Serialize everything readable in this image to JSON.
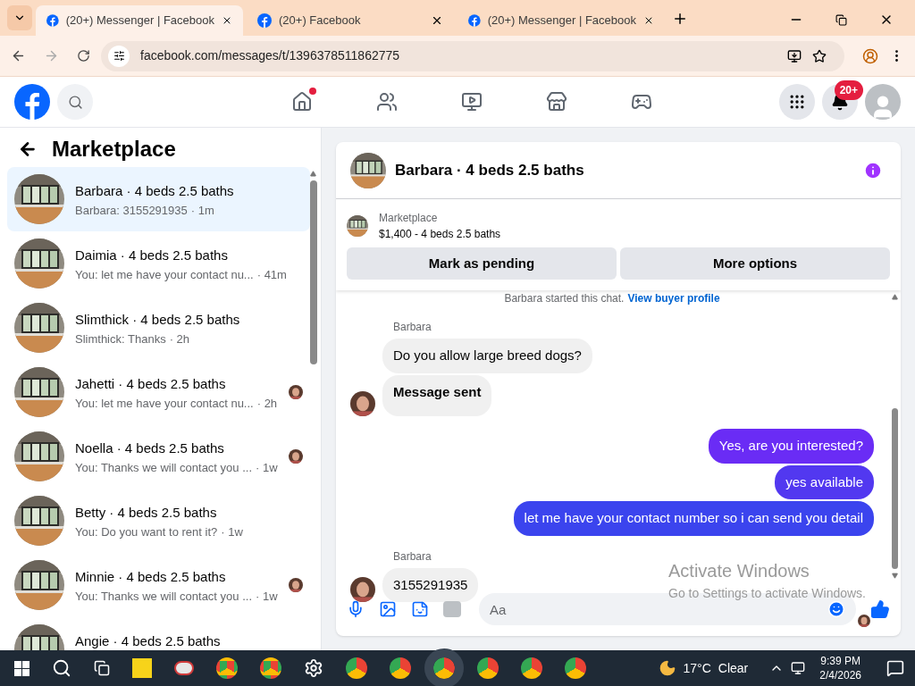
{
  "browser": {
    "tabs": [
      {
        "title": "(20+) Messenger | Facebook",
        "selected": true
      },
      {
        "title": "(20+) Facebook",
        "selected": false
      },
      {
        "title": "(20+) Messenger | Facebook",
        "selected": false
      }
    ],
    "url": "facebook.com/messages/t/1396378511862775"
  },
  "top_nav": {
    "home_unread": true,
    "notification_badge": "20+"
  },
  "sidebar": {
    "title": "Marketplace",
    "conversations": [
      {
        "title": "Barbara · 4 beds 2.5 baths",
        "preview": "Barbara: 3155291935",
        "time": "· 1m",
        "selected": true,
        "seen_avatar": false
      },
      {
        "title": "Daimia · 4 beds 2.5 baths",
        "preview": "You: let me have your contact nu...",
        "time": "· 41m",
        "selected": false,
        "seen_avatar": false
      },
      {
        "title": "Slimthick · 4 beds 2.5 baths",
        "preview": "Slimthick: Thanks",
        "time": "· 2h",
        "selected": false,
        "seen_avatar": false
      },
      {
        "title": "Jahetti · 4 beds 2.5 baths",
        "preview": "You: let me have your contact nu...",
        "time": "· 2h",
        "selected": false,
        "seen_avatar": true
      },
      {
        "title": "Noella · 4 beds 2.5 baths",
        "preview": "You: Thanks we will contact you ...",
        "time": "· 1w",
        "selected": false,
        "seen_avatar": true
      },
      {
        "title": "Betty · 4 beds 2.5 baths",
        "preview": "You: Do you want to rent it?",
        "time": "· 1w",
        "selected": false,
        "seen_avatar": false
      },
      {
        "title": "Minnie · 4 beds 2.5 baths",
        "preview": "You: Thanks we will contact you ...",
        "time": "· 1w",
        "selected": false,
        "seen_avatar": true
      },
      {
        "title": "Angie · 4 beds 2.5 baths",
        "selected": false,
        "seen_avatar": false
      }
    ]
  },
  "chat": {
    "title": "Barbara · 4 beds 2.5 baths",
    "listing": {
      "label": "Marketplace",
      "name": "$1,400 - 4 beds 2.5 baths"
    },
    "buttons": [
      "Mark as pending",
      "More options"
    ],
    "note": {
      "text": "Barbara started this chat.",
      "link": "View buyer profile"
    },
    "messages": [
      {
        "kind": "incoming",
        "sender": "Barbara",
        "text": "Do you allow large breed dogs?",
        "bold": false,
        "avatar": false
      },
      {
        "kind": "incoming",
        "text": "Message sent",
        "bold": true,
        "avatar": true
      },
      {
        "kind": "outgoing",
        "text": "Yes, are you interested?",
        "color": "#6a2cf5"
      },
      {
        "kind": "outgoing",
        "text": "yes available",
        "color": "#5238f0"
      },
      {
        "kind": "outgoing",
        "text": "let me have your contact number so i can send you detail",
        "color": "#3b44ee"
      },
      {
        "kind": "incoming",
        "sender": "Barbara",
        "text": "3155291935",
        "bold": false,
        "avatar": true
      }
    ],
    "composer": {
      "placeholder": "Aa"
    }
  },
  "activation": {
    "title": "Activate Windows",
    "subtitle": "Go to Settings to activate Windows."
  },
  "taskbar": {
    "temperature": "17°C",
    "condition": "Clear",
    "time": "9:39 PM",
    "date": "2/4/2026"
  }
}
